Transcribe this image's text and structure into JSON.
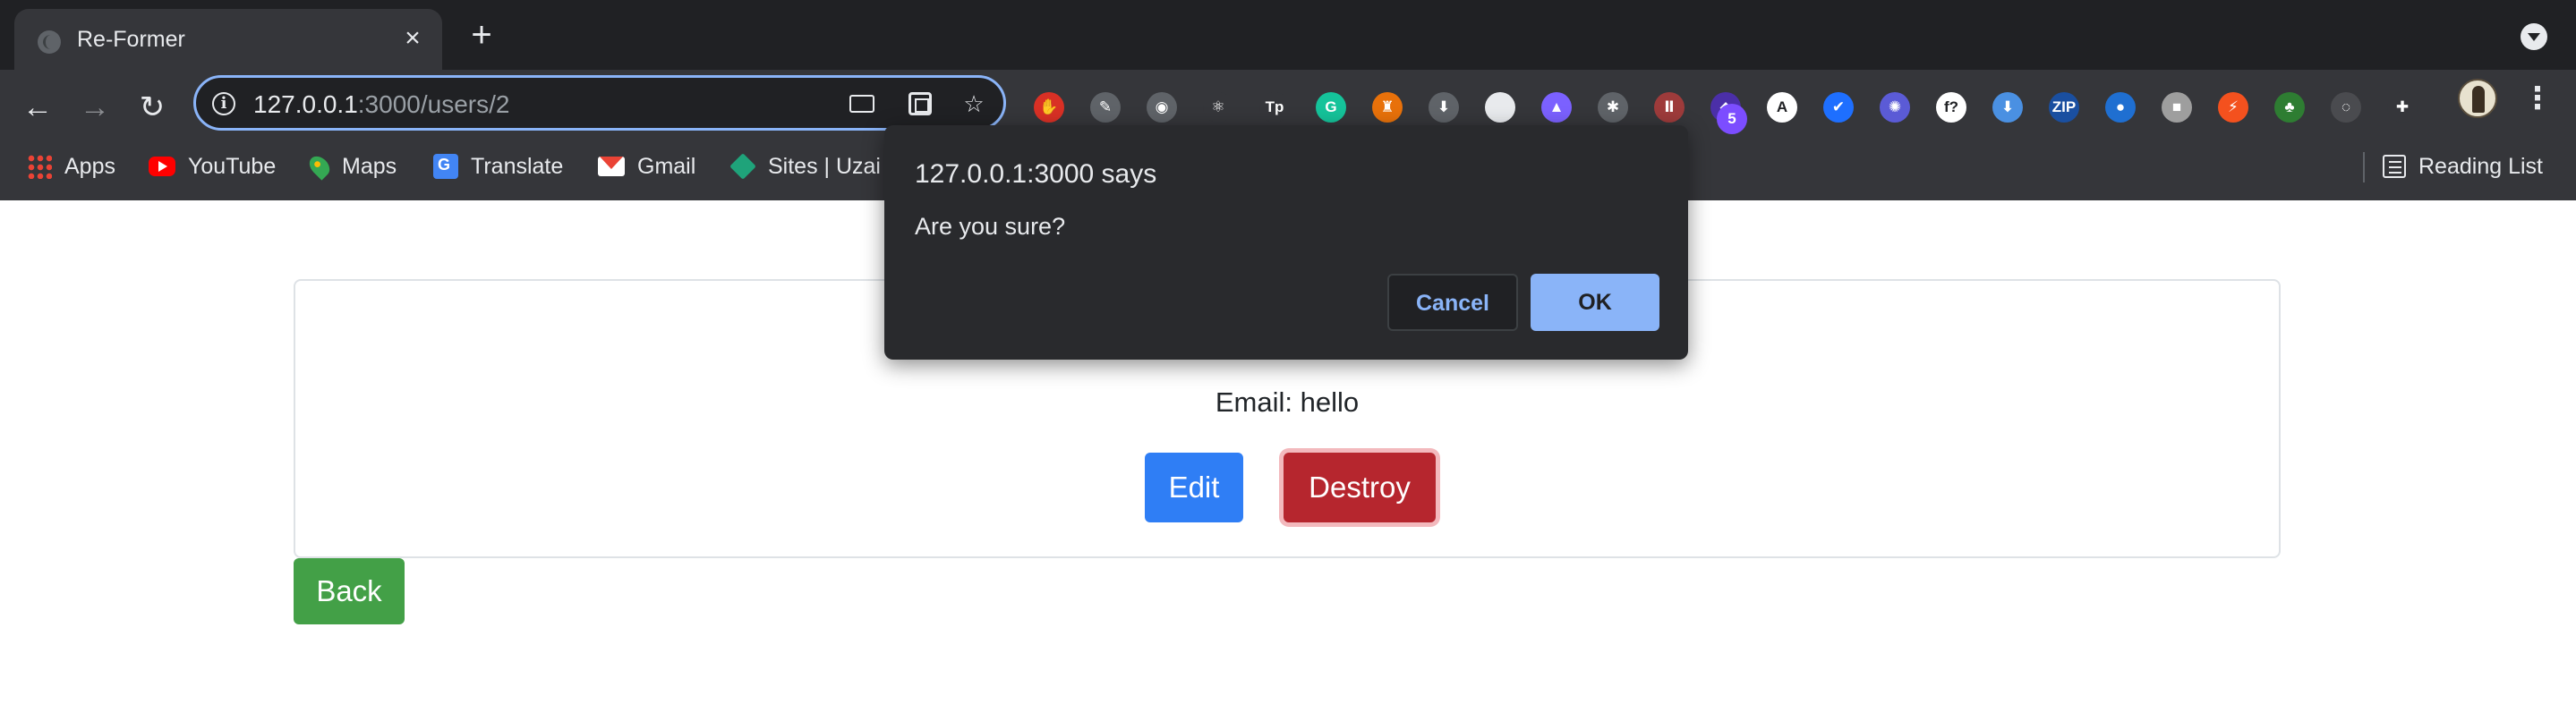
{
  "tab": {
    "title": "Re-Former",
    "close_glyph": "×",
    "new_tab_glyph": "+"
  },
  "toolbar": {
    "url_host": "127.0.0.1",
    "url_path": ":3000/users/2",
    "back_glyph": "←",
    "forward_glyph": "→",
    "reload_glyph": "↻",
    "star_glyph": "☆",
    "kebab_glyph": "⋮",
    "info_glyph": "i",
    "extensions": [
      {
        "icon": "stop-hand-icon",
        "color": "#d93025",
        "glyph": "✋",
        "badge": ""
      },
      {
        "icon": "eyedropper-icon",
        "color": "#5f6368",
        "glyph": "✎",
        "badge": ""
      },
      {
        "icon": "camera-icon",
        "color": "#5f6368",
        "glyph": "◉",
        "badge": ""
      },
      {
        "icon": "react-devtools-icon",
        "color": "#35363a",
        "glyph": "⚛",
        "badge": ""
      },
      {
        "icon": "tp-icon",
        "color": "#35363a",
        "glyph": "Tp",
        "badge": ""
      },
      {
        "icon": "grammarly-icon",
        "color": "#15c39a",
        "glyph": "G",
        "badge": ""
      },
      {
        "icon": "lighthouse-icon",
        "color": "#e8710a",
        "glyph": "♜",
        "badge": ""
      },
      {
        "icon": "download-arrow-icon",
        "color": "#5f6368",
        "glyph": "⬇",
        "badge": ""
      },
      {
        "icon": "white-circle-icon",
        "color": "#e8eaed",
        "glyph": "",
        "badge": ""
      },
      {
        "icon": "purple-mountain-icon",
        "color": "#7b61ff",
        "glyph": "▲",
        "badge": ""
      },
      {
        "icon": "bug-icon",
        "color": "#5f6368",
        "glyph": "✱",
        "badge": ""
      },
      {
        "icon": "colorful-tubes-icon",
        "color": "#9e3b3b",
        "glyph": "Ⅱ",
        "badge": ""
      },
      {
        "icon": "purple-box-icon",
        "color": "#4b2fa8",
        "glyph": "◆",
        "badge": "5"
      },
      {
        "icon": "a-circle-icon",
        "color": "#ffffff",
        "glyph": "A",
        "badge": ""
      },
      {
        "icon": "blue-check-icon",
        "color": "#1e6fff",
        "glyph": "✔",
        "badge": ""
      },
      {
        "icon": "blue-gear-icon",
        "color": "#5b5bd6",
        "glyph": "✺",
        "badge": ""
      },
      {
        "icon": "f-question-icon",
        "color": "#ffffff",
        "glyph": "f?",
        "badge": ""
      },
      {
        "icon": "download-blue-icon",
        "color": "#4a90e2",
        "glyph": "⬇",
        "badge": ""
      },
      {
        "icon": "zip-icon",
        "color": "#1a4fa0",
        "glyph": "ZIP",
        "badge": ""
      },
      {
        "icon": "globe-icon",
        "color": "#1f6fd1",
        "glyph": "●",
        "badge": ""
      },
      {
        "icon": "gray-square-icon",
        "color": "#9e9e9e",
        "glyph": "■",
        "badge": ""
      },
      {
        "icon": "orange-tool-icon",
        "color": "#f4511e",
        "glyph": "⚡",
        "badge": ""
      },
      {
        "icon": "green-tree-icon",
        "color": "#2e7d32",
        "glyph": "♣",
        "badge": ""
      },
      {
        "icon": "disabled-circle-icon",
        "color": "#4a4b4f",
        "glyph": "◌",
        "badge": ""
      },
      {
        "icon": "puzzle-icon",
        "color": "#35363a",
        "glyph": "✚",
        "badge": ""
      }
    ]
  },
  "bookmarks": [
    {
      "label": "Apps",
      "icon": "apps-grid-icon"
    },
    {
      "label": "YouTube",
      "icon": "youtube-icon"
    },
    {
      "label": "Maps",
      "icon": "maps-icon"
    },
    {
      "label": "Translate",
      "icon": "translate-icon"
    },
    {
      "label": "Gmail",
      "icon": "gmail-icon"
    },
    {
      "label": "Sites | Uzai",
      "icon": "sites-icon"
    }
  ],
  "reading_list": {
    "label": "Reading List",
    "icon": "reading-list-icon"
  },
  "page": {
    "email_text": "Email: hello",
    "edit_label": "Edit",
    "destroy_label": "Destroy",
    "back_label": "Back"
  },
  "dialog": {
    "title": "127.0.0.1:3000 says",
    "message": "Are you sure?",
    "cancel_label": "Cancel",
    "ok_label": "OK"
  }
}
